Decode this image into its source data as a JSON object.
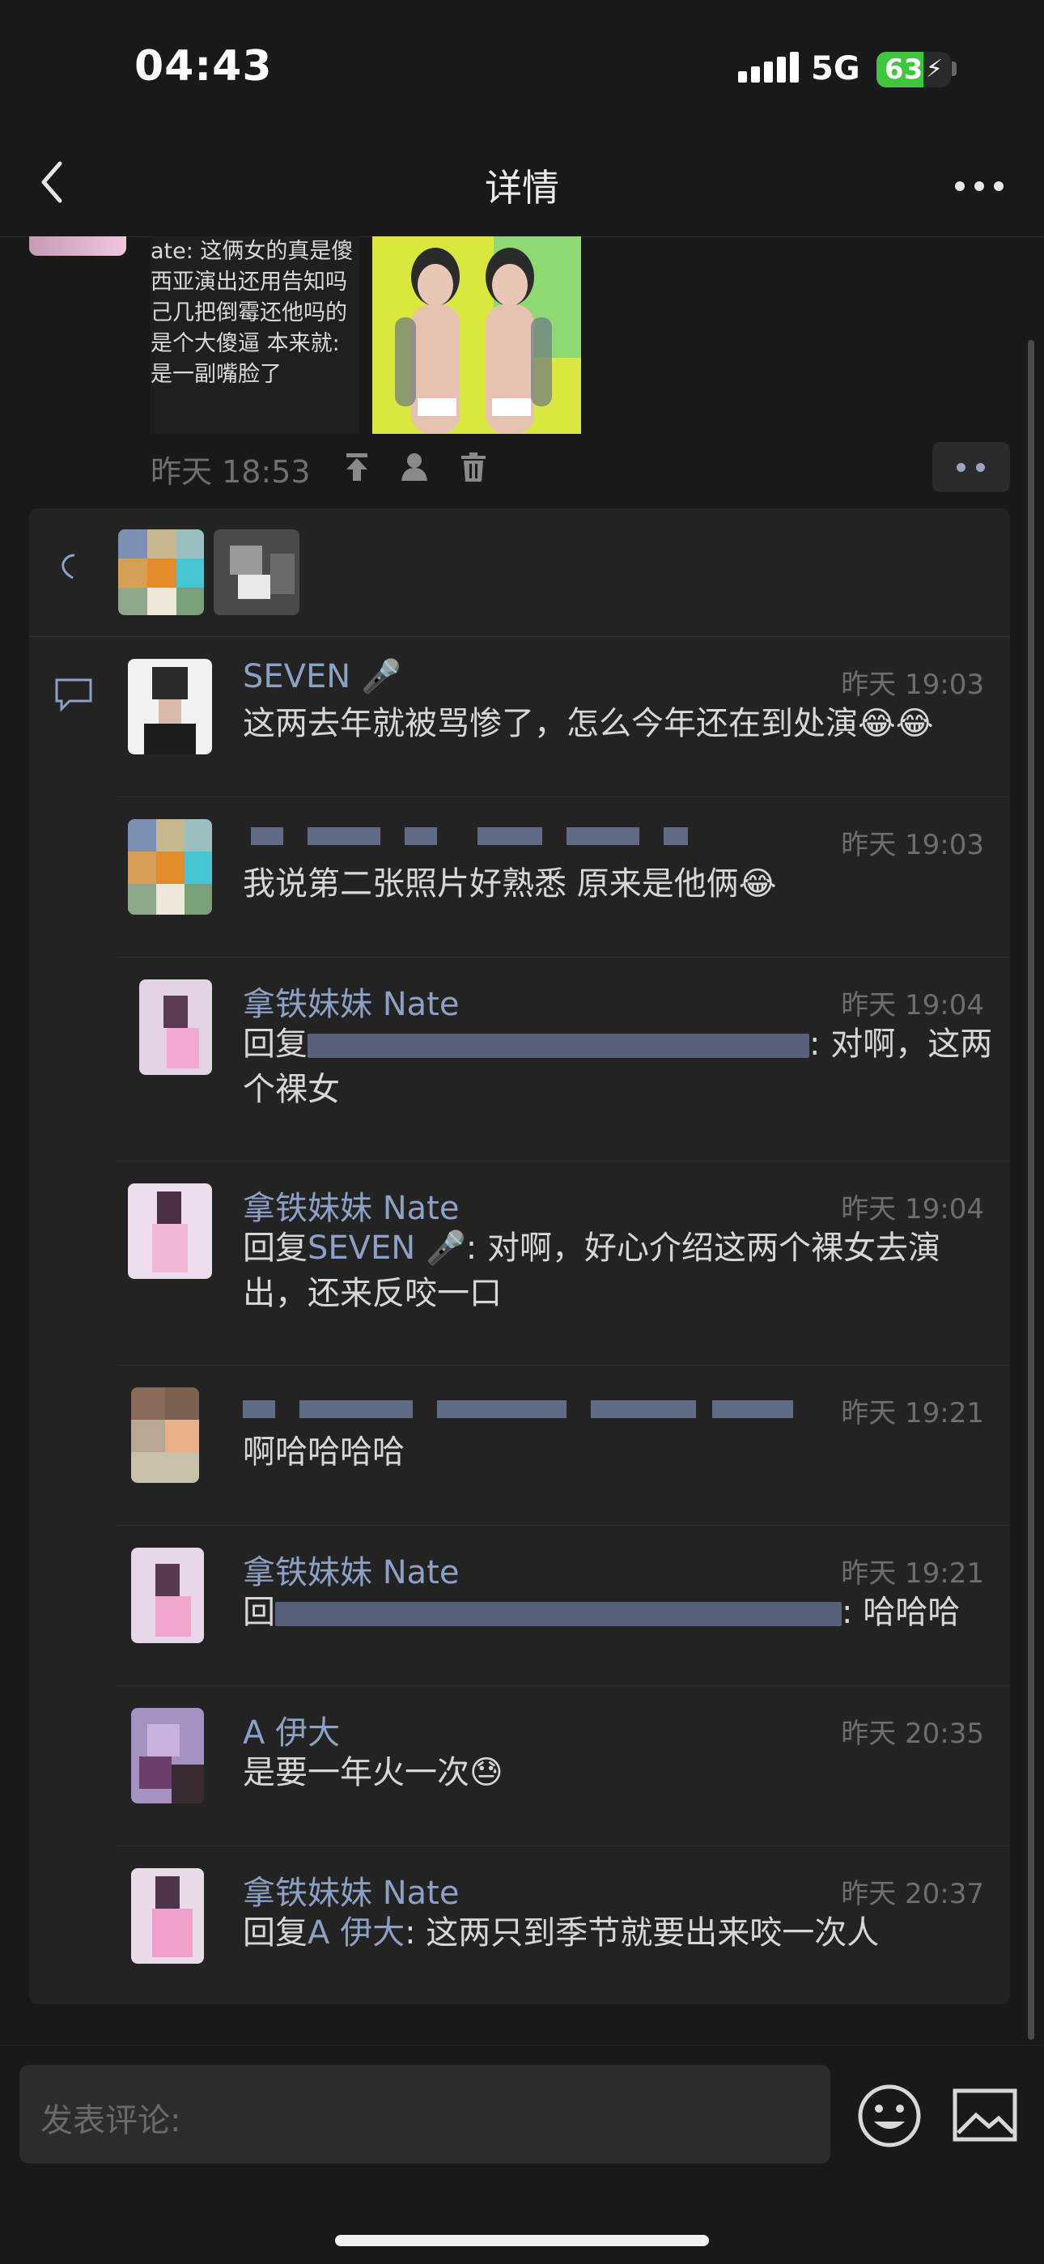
{
  "status": {
    "time": "04:43",
    "network": "5G",
    "battery": "63",
    "battery_level": 0.63
  },
  "nav": {
    "title": "详情"
  },
  "post": {
    "image_text_lines": [
      "ate: 这俩女的真是傻",
      "西亚演出还用告知吗",
      "己几把倒霉还他吗的",
      "是个大傻逼 本来就:",
      "是一副嘴脸了"
    ],
    "time": "昨天 18:53"
  },
  "comments": [
    {
      "name": "SEVEN 🎤",
      "time": "昨天 19:03",
      "prefix": "",
      "reply_to": "",
      "text": "这两去年就被骂惨了，怎么今年还在到处演😂😂"
    },
    {
      "name": "",
      "time": "昨天 19:03",
      "prefix": "",
      "reply_to": "",
      "text": "我说第二张照片好熟悉 原来是他俩😂"
    },
    {
      "name": "拿铁妹妹 Nate",
      "time": "昨天 19:04",
      "prefix": "回复",
      "reply_to": "",
      "text": ": 对啊，这两个裸女"
    },
    {
      "name": "拿铁妹妹 Nate",
      "time": "昨天 19:04",
      "prefix": "回复",
      "reply_to": "SEVEN 🎤",
      "text": ": 对啊，好心介绍这两个裸女去演出，还来反咬一口"
    },
    {
      "name": "",
      "time": "昨天 19:21",
      "prefix": "",
      "reply_to": "",
      "text": "啊哈哈哈哈"
    },
    {
      "name": "拿铁妹妹 Nate",
      "time": "昨天 19:21",
      "prefix": "回",
      "reply_to": "",
      "text": ": 哈哈哈"
    },
    {
      "name": "A 伊大",
      "time": "昨天 20:35",
      "prefix": "",
      "reply_to": "",
      "text": "是要一年火一次😓"
    },
    {
      "name": "拿铁妹妹 Nate",
      "time": "昨天 20:37",
      "prefix": "回复",
      "reply_to": "A 伊大",
      "text": ": 这两只到季节就要出来咬一次人"
    }
  ],
  "input": {
    "placeholder": "发表评论:"
  },
  "colors": {
    "background": "#191919",
    "panel": "#232323",
    "name_link": "#8da1c7",
    "battery_green": "#3ec63e"
  }
}
